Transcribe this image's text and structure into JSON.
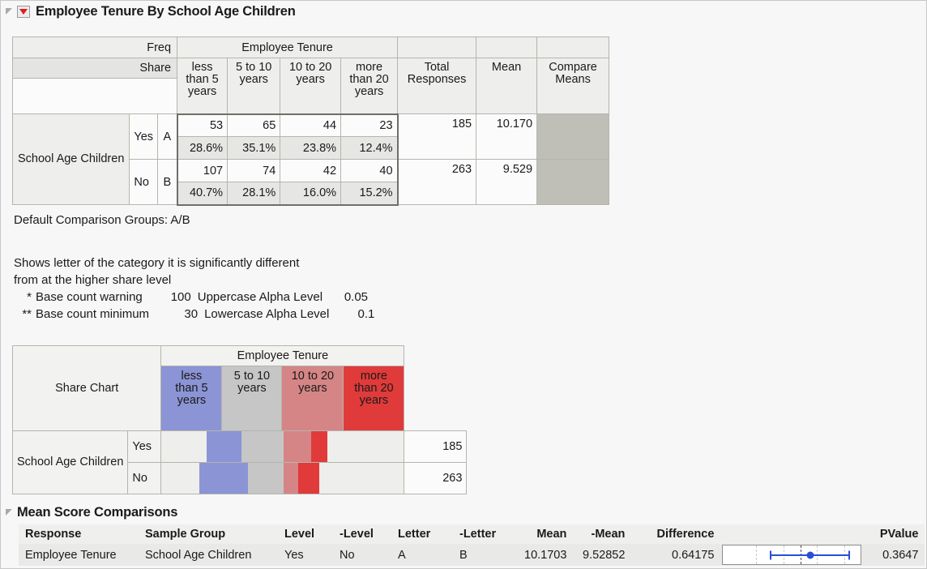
{
  "section1": {
    "title": "Employee Tenure By School Age Children",
    "disclosure_icon": "triangle-collapse-icon",
    "menu_icon": "red-triangle-menu-icon"
  },
  "crosstab": {
    "freq_label": "Freq",
    "share_label": "Share",
    "group_header": "Employee Tenure",
    "row_label": "School Age Children",
    "columns": [
      "less than 5 years",
      "5 to 10 years",
      "10 to 20 years",
      "more than 20 years"
    ],
    "column_lines": [
      [
        "less",
        "than 5",
        "years"
      ],
      [
        "5 to 10",
        "years",
        ""
      ],
      [
        "10 to 20",
        "years",
        ""
      ],
      [
        "more",
        "than 20",
        "years"
      ]
    ],
    "total_header_lines": [
      "Total",
      "Responses"
    ],
    "mean_header": "Mean",
    "compare_header_lines": [
      "Compare",
      "Means"
    ],
    "rows": [
      {
        "category": "Yes",
        "letter": "A",
        "freq": [
          "53",
          "65",
          "44",
          "23"
        ],
        "share": [
          "28.6%",
          "35.1%",
          "23.8%",
          "12.4%"
        ],
        "total": "185",
        "mean": "10.170",
        "compare": ""
      },
      {
        "category": "No",
        "letter": "B",
        "freq": [
          "107",
          "74",
          "42",
          "40"
        ],
        "share": [
          "40.7%",
          "28.1%",
          "16.0%",
          "15.2%"
        ],
        "total": "263",
        "mean": "9.529",
        "compare": ""
      }
    ]
  },
  "notes": {
    "default_groups": "Default Comparison Groups: A/B",
    "shows_line1": "Shows letter of the category it is significantly different",
    "shows_line2": "from at the higher share level",
    "alpha_rows": [
      {
        "marker": "*",
        "label": "Base count warning",
        "value": "100",
        "alpha_label": "Uppercase Alpha Level",
        "alpha_value": "0.05"
      },
      {
        "marker": "**",
        "label": "Base count minimum",
        "value": "30",
        "alpha_label": "Lowercase Alpha Level",
        "alpha_value": "0.1"
      }
    ]
  },
  "share_chart": {
    "corner_label": "Share Chart",
    "group_header": "Employee Tenure",
    "row_label": "School Age Children",
    "column_lines": [
      [
        "less",
        "than 5",
        "years"
      ],
      [
        "5 to 10",
        "years",
        ""
      ],
      [
        "10 to 20",
        "years",
        ""
      ],
      [
        "more",
        "than 20",
        "years"
      ]
    ],
    "column_colors": [
      "#8b94d4",
      "#c6c6c6",
      "#d58585",
      "#e03a3a"
    ],
    "rows": [
      {
        "category": "Yes",
        "total": "185"
      },
      {
        "category": "No",
        "total": "263"
      }
    ]
  },
  "chart_data": {
    "type": "bar",
    "title": "Share Chart",
    "xlabel": "Employee Tenure",
    "ylabel": "School Age Children",
    "categories": [
      "less than 5 years",
      "5 to 10 years",
      "10 to 20 years",
      "more than 20 years"
    ],
    "series": [
      {
        "name": "Yes",
        "values": [
          28.6,
          35.1,
          23.8,
          12.4
        ],
        "counts": [
          53,
          65,
          44,
          23
        ],
        "total": 185,
        "mean": 10.17
      },
      {
        "name": "No",
        "values": [
          40.7,
          28.1,
          16.0,
          15.2
        ],
        "counts": [
          107,
          74,
          42,
          40
        ],
        "total": 263,
        "mean": 9.529
      }
    ],
    "colors": [
      "#8b94d4",
      "#c6c6c6",
      "#d58585",
      "#e03a3a"
    ],
    "ylim": [
      0,
      100
    ],
    "grid": false,
    "legend": "none"
  },
  "section2": {
    "title": "Mean Score Comparisons",
    "disclosure_icon": "triangle-collapse-icon"
  },
  "comparisons_table": {
    "headers": [
      "Response",
      "Sample Group",
      "Level",
      "-Level",
      "Letter",
      "-Letter",
      "Mean",
      "-Mean",
      "Difference",
      "",
      "PValue"
    ],
    "rows": [
      {
        "response": "Employee Tenure",
        "sample_group": "School Age Children",
        "level": "Yes",
        "neg_level": "No",
        "letter": "A",
        "neg_letter": "B",
        "mean": "10.1703",
        "neg_mean": "9.52852",
        "difference": "0.64175",
        "pvalue": "0.3647"
      }
    ]
  }
}
